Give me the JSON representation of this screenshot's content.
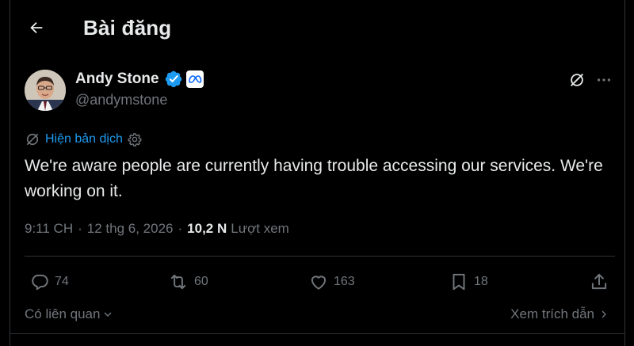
{
  "header": {
    "title": "Bài đăng"
  },
  "author": {
    "name": "Andy Stone",
    "handle": "@andymstone",
    "verified_color": "#1d9bf0"
  },
  "translation": {
    "label": "Hiện bản dịch"
  },
  "tweet": {
    "text": "We're aware people are currently having trouble accessing our services. We're working on it.",
    "time": "9:11 CH",
    "date": "12 thg 6, 2026",
    "separator": "·",
    "views_count": "10,2 N",
    "views_label": "Lượt xem"
  },
  "actions": {
    "replies": "74",
    "reposts": "60",
    "likes": "163",
    "bookmarks": "18"
  },
  "footer": {
    "related_label": "Có liên quan",
    "quotes_label": "Xem trích dẫn"
  },
  "colors": {
    "background": "#000000",
    "text_primary": "#e7e9ea",
    "text_secondary": "#71767b",
    "accent": "#1d9bf0",
    "border": "#2f3336"
  },
  "icons": [
    "arrow-left-icon",
    "verified-badge-icon",
    "meta-logo-icon",
    "grok-icon",
    "more-icon",
    "translate-icon",
    "gear-icon",
    "reply-icon",
    "repost-icon",
    "like-icon",
    "bookmark-icon",
    "share-icon",
    "chevron-down-icon",
    "chevron-right-icon"
  ]
}
